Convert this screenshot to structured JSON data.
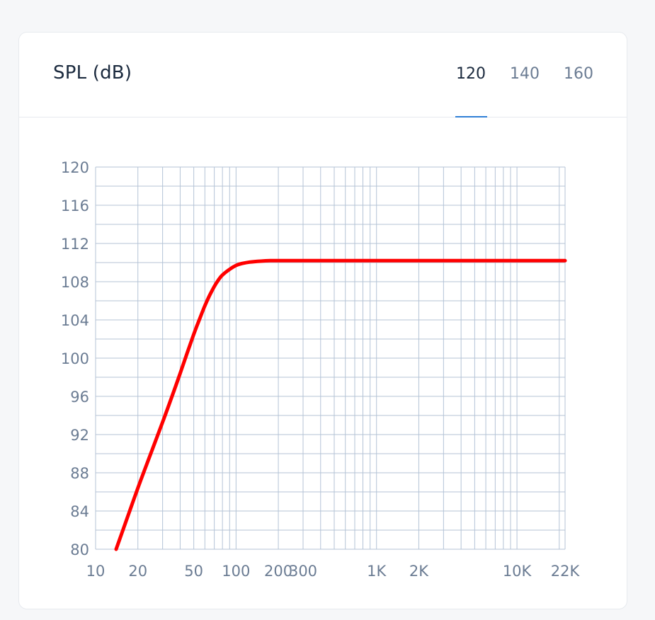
{
  "card": {
    "title": "SPL (dB)",
    "tabs": [
      {
        "label": "120",
        "active": true
      },
      {
        "label": "140",
        "active": false
      },
      {
        "label": "160",
        "active": false
      }
    ]
  },
  "colors": {
    "curve": "#ff0000",
    "grid": "#b4c3d6",
    "tick_label": "#6b7c93",
    "tab_active": "#1b2a3e",
    "tab_inactive": "#6b7c93",
    "tab_indicator": "#2f7fd6"
  },
  "chart_data": {
    "type": "line",
    "title": "SPL (dB)",
    "xlabel": "",
    "ylabel": "",
    "x_scale": "log",
    "xlim": [
      10,
      22000
    ],
    "ylim": [
      80,
      120
    ],
    "grid": true,
    "y_ticks": [
      120,
      116,
      112,
      108,
      104,
      100,
      96,
      92,
      88,
      84,
      80
    ],
    "x_ticks": [
      {
        "value": 10,
        "label": "10"
      },
      {
        "value": 20,
        "label": "20"
      },
      {
        "value": 50,
        "label": "50"
      },
      {
        "value": 100,
        "label": "100"
      },
      {
        "value": 200,
        "label": "200"
      },
      {
        "value": 300,
        "label": "300"
      },
      {
        "value": 1000,
        "label": "1K"
      },
      {
        "value": 2000,
        "label": "2K"
      },
      {
        "value": 10000,
        "label": "10K"
      },
      {
        "value": 22000,
        "label": "22K"
      }
    ],
    "series": [
      {
        "x": [
          14,
          16,
          20,
          25,
          30,
          35,
          40,
          45,
          50,
          55,
          60,
          65,
          70,
          75,
          80,
          90,
          100,
          110,
          125,
          150,
          175,
          200,
          250,
          300,
          400,
          500,
          1000,
          2000,
          5000,
          10000,
          22000
        ],
        "y": [
          80.0,
          82.4,
          86.4,
          90.2,
          93.3,
          96.0,
          98.4,
          100.6,
          102.5,
          104.1,
          105.5,
          106.6,
          107.5,
          108.2,
          108.7,
          109.3,
          109.7,
          109.9,
          110.05,
          110.15,
          110.2,
          110.2,
          110.2,
          110.2,
          110.2,
          110.2,
          110.2,
          110.2,
          110.2,
          110.2,
          110.2
        ]
      }
    ]
  }
}
